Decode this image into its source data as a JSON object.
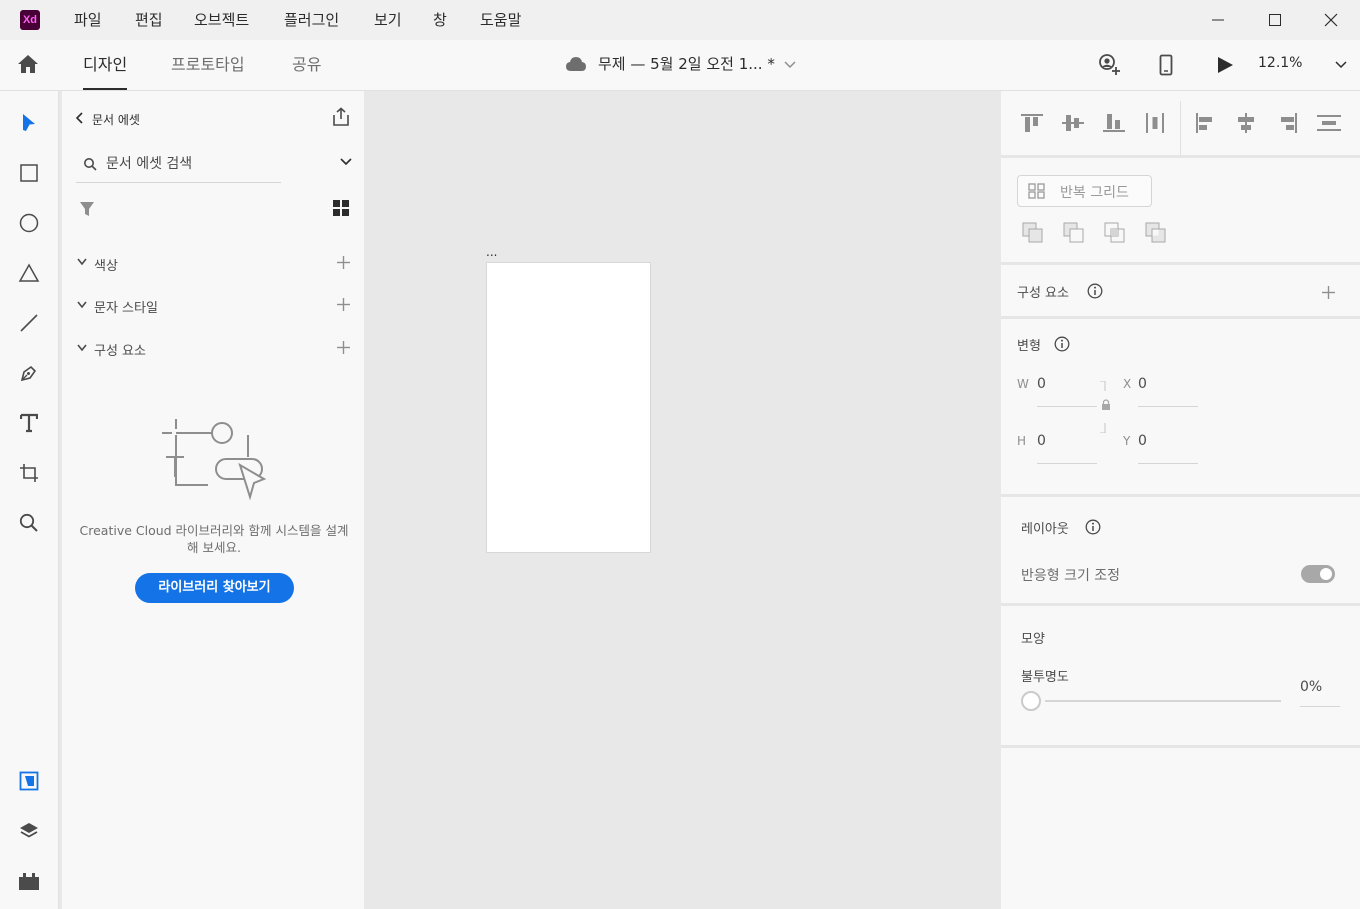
{
  "app": {
    "logo_text": "Xd",
    "brand_color": "#ff61f6",
    "accent_color": "#1473e6"
  },
  "menu": [
    "파일",
    "편집",
    "오브젝트",
    "플러그인",
    "보기",
    "창",
    "도움말"
  ],
  "window_controls": [
    "minimize-icon",
    "maximize-icon",
    "close-icon"
  ],
  "toolbar": {
    "tabs": [
      {
        "label": "디자인",
        "active": true
      },
      {
        "label": "프로토타입",
        "active": false
      },
      {
        "label": "공유",
        "active": false
      }
    ],
    "doc_title": "무제 — 5월 2일 오전 1... *",
    "zoom": "12.1%"
  },
  "tools": [
    "select-tool-icon",
    "rectangle-tool-icon",
    "ellipse-tool-icon",
    "polygon-tool-icon",
    "line-tool-icon",
    "pen-tool-icon",
    "text-tool-icon",
    "artboard-tool-icon",
    "zoom-tool-icon",
    "document-assets-icon",
    "layers-icon",
    "plugins-icon"
  ],
  "assets": {
    "title": "문서 에셋",
    "search_placeholder": "문서 에셋 검색",
    "sections": [
      "색상",
      "문자 스타일",
      "구성 요소"
    ],
    "empty_message": "Creative Cloud 라이브러리와 함께 시스템을 설계해 보세요.",
    "browse_button": "라이브러리 찾아보기"
  },
  "canvas": {
    "artboard_label": "..."
  },
  "inspector": {
    "repeat_grid": "반복 그리드",
    "components_title": "구성 요소",
    "transform_title": "변형",
    "w_label": "W",
    "w_value": "0",
    "h_label": "H",
    "h_value": "0",
    "x_label": "X",
    "x_value": "0",
    "y_label": "Y",
    "y_value": "0",
    "layout_title": "레이아웃",
    "responsive_resize": "반응형 크기 조정",
    "appearance_title": "모양",
    "opacity_label": "불투명도",
    "opacity_value": "0%"
  }
}
